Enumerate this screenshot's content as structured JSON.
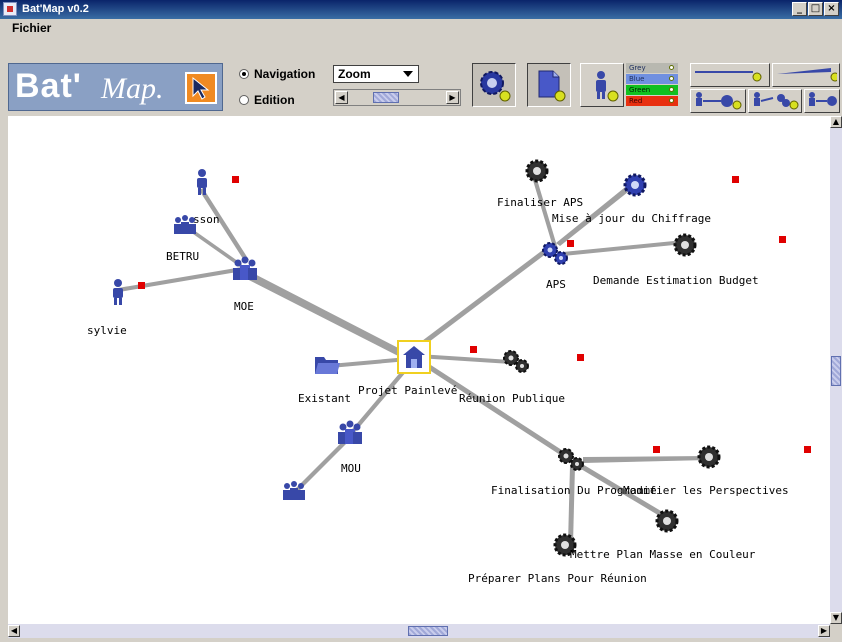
{
  "window": {
    "title": "Bat'Map v0.2",
    "controls": {
      "minimize": "_",
      "maximize": "□",
      "close": "×"
    }
  },
  "menu": {
    "items": [
      "Fichier"
    ]
  },
  "logo": {
    "text_main": "Bat'",
    "text_script": "Map."
  },
  "mode": {
    "options": [
      {
        "label": "Navigation",
        "selected": true
      },
      {
        "label": "Edition",
        "selected": false
      }
    ]
  },
  "zoom": {
    "selected": "Zoom",
    "slider_fraction": 0.35
  },
  "toolbar": {
    "buttons": [
      {
        "icon": "gear-node-icon",
        "active": true
      },
      {
        "icon": "document-node-icon",
        "active": true
      },
      {
        "icon": "person-node-icon",
        "active": false
      }
    ]
  },
  "levels": {
    "items": [
      {
        "label": "Grey",
        "color": "#b8b8b0"
      },
      {
        "label": "Blue",
        "color": "#7090e0"
      },
      {
        "label": "Green",
        "color": "#10c020"
      },
      {
        "label": "Red",
        "color": "#e83010"
      }
    ]
  },
  "colors": {
    "badge": "#e00000",
    "edge": "#a0a0a0",
    "selection": "#f0d020",
    "node_blue": "#3848a8",
    "node_dark": "#303030"
  },
  "graph": {
    "labels": {
      "ssou": "sson",
      "betru": "BETRU",
      "moe": "MOE",
      "sylvie": "sylvie",
      "finaliser_aps": "Finaliser APS",
      "mise_a_jour": "Mise à jour du Chiffrage",
      "aps": "APS",
      "demande_estimation": "Demande Estimation Budget",
      "existant": "Existant",
      "projet": "Projet Painlevé",
      "reunion": "Réunion Publique",
      "mou": "MOU",
      "finalisation": "Finalisation Du Programme",
      "modifier": "Modifier les Perspectives",
      "mettre_plan": "Mettre Plan Masse en Couleur",
      "preparer": "Préparer Plans Pour Réunion"
    }
  }
}
